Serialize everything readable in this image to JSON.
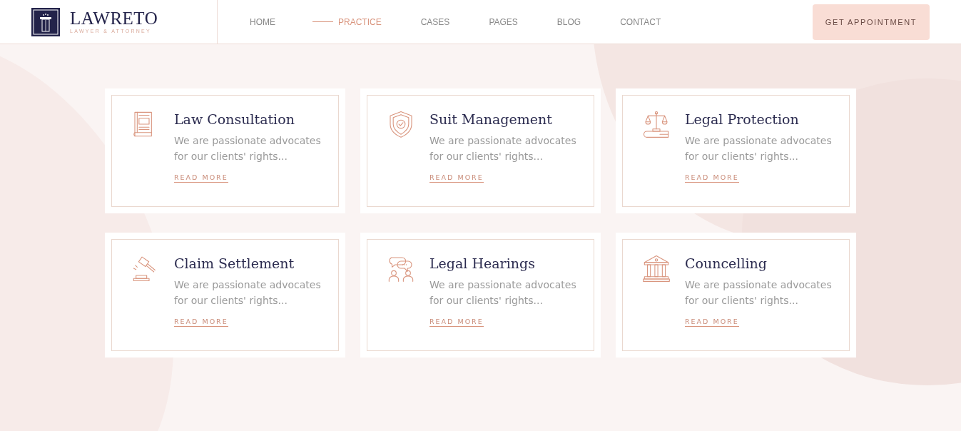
{
  "header": {
    "logo": {
      "name": "LAWRETO",
      "tagline": "LAWYER & ATTORNEY"
    },
    "nav": [
      {
        "label": "HOME",
        "selected": false
      },
      {
        "label": "PRACTICE",
        "selected": true
      },
      {
        "label": "CASES",
        "selected": false
      },
      {
        "label": "PAGES",
        "selected": false
      },
      {
        "label": "BLOG",
        "selected": false
      },
      {
        "label": "CONTACT",
        "selected": false
      }
    ],
    "cta": "GET APPOINTMENT"
  },
  "services": [
    {
      "kind": "book",
      "title": "Law Consultation",
      "text": "We are passionate advocates for our clients' rights...",
      "link": "READ MORE"
    },
    {
      "kind": "shield",
      "title": "Suit Management",
      "text": "We are passionate advocates for our clients' rights...",
      "link": "READ MORE"
    },
    {
      "kind": "scales",
      "title": "Legal Protection",
      "text": "We are passionate advocates for our clients' rights...",
      "link": "READ MORE"
    },
    {
      "kind": "gavel",
      "title": "Claim Settlement",
      "text": "We are passionate advocates for our clients' rights...",
      "link": "READ MORE"
    },
    {
      "kind": "people",
      "title": "Legal Hearings",
      "text": "We are passionate advocates for our clients' rights...",
      "link": "READ MORE"
    },
    {
      "kind": "building",
      "title": "Councelling",
      "text": "We are passionate advocates for our clients' rights...",
      "link": "READ MORE"
    }
  ]
}
